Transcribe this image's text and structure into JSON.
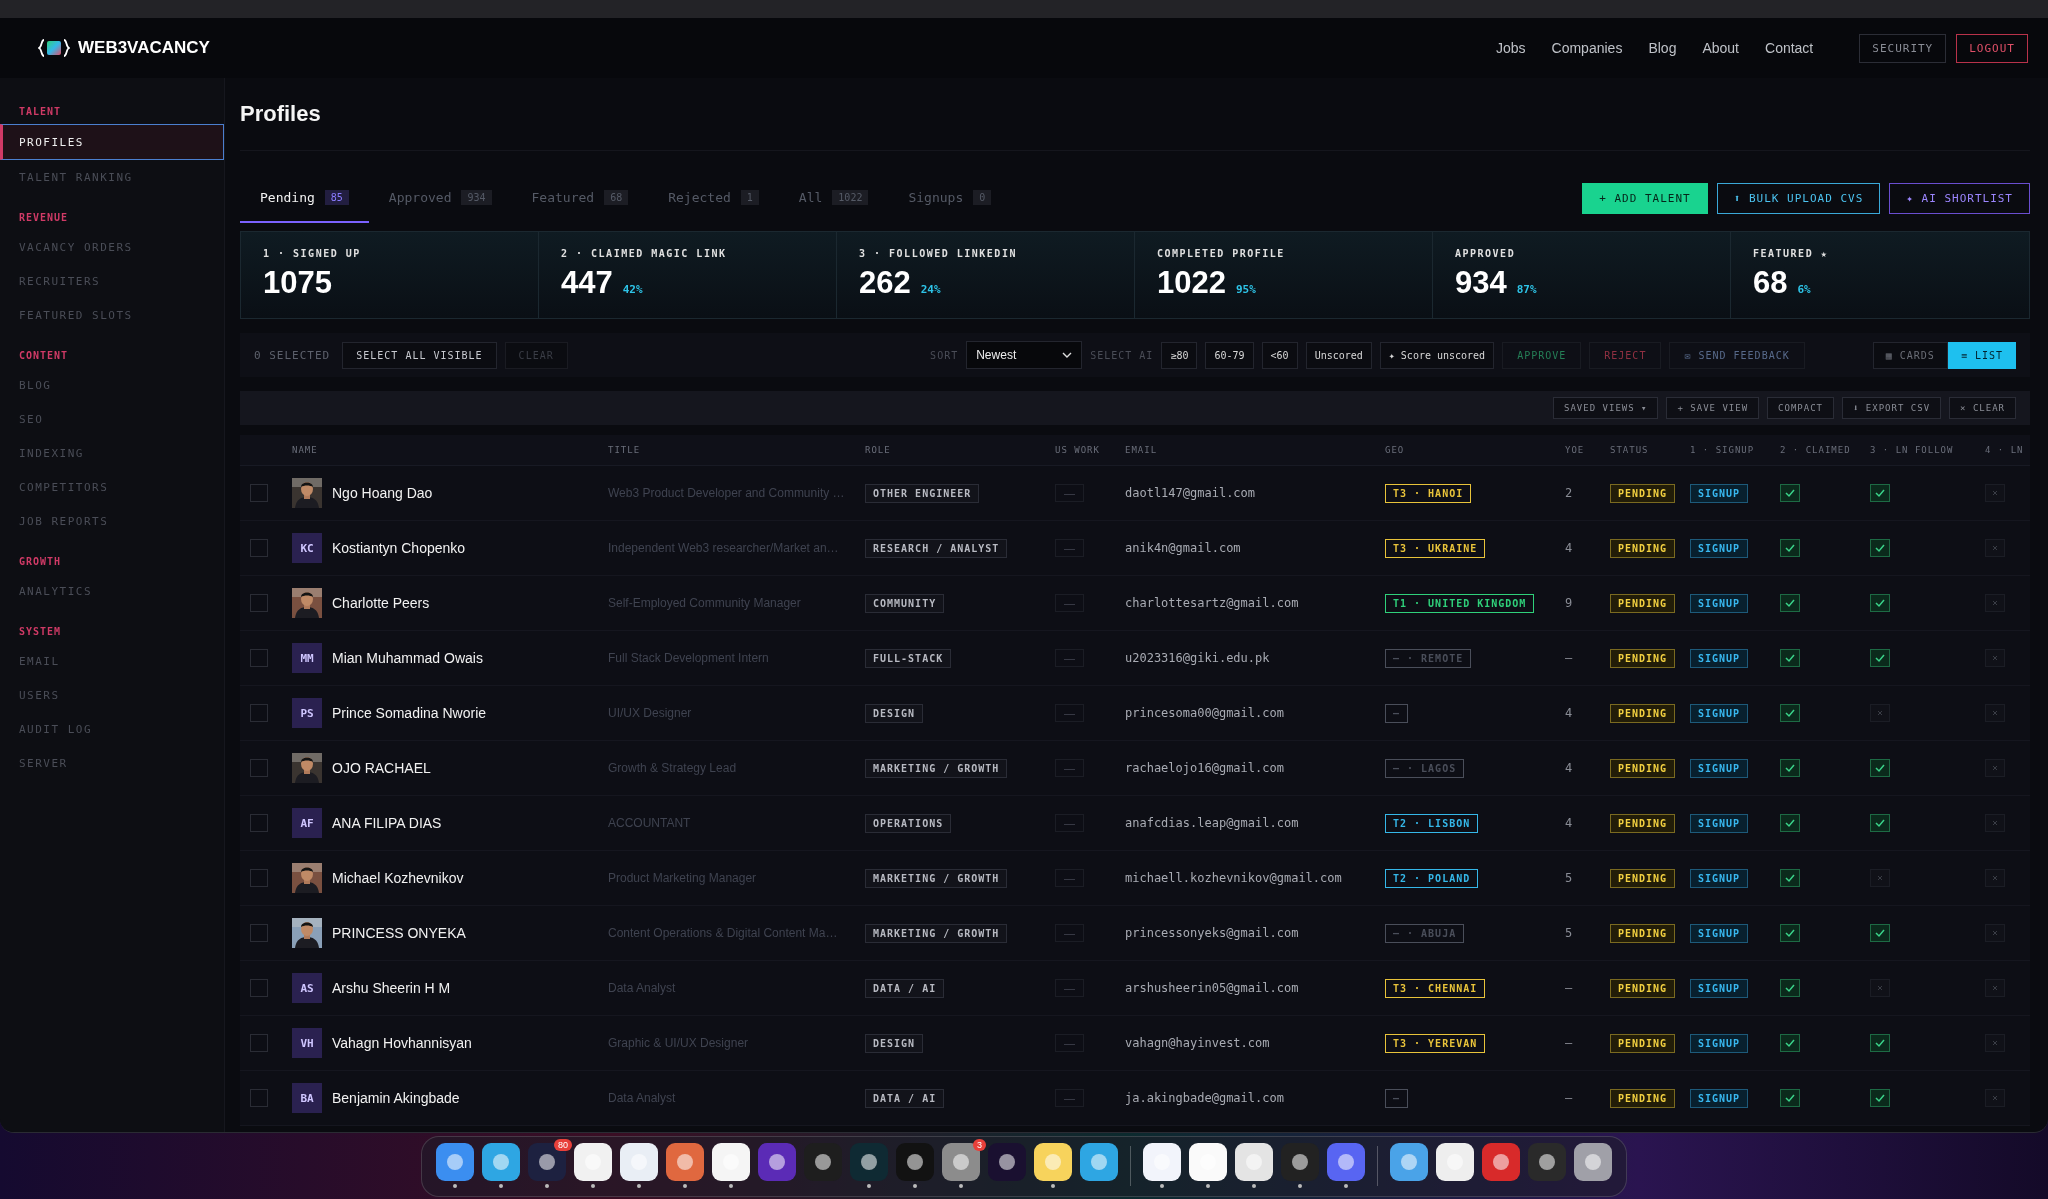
{
  "header": {
    "brand": "WEB3VACANCY",
    "nav": [
      "Jobs",
      "Companies",
      "Blog",
      "About",
      "Contact"
    ],
    "buttons": [
      {
        "label": "SECURITY",
        "kind": "plain"
      },
      {
        "label": "LOGOUT",
        "kind": "danger"
      }
    ]
  },
  "sidebar": {
    "sections": [
      {
        "label": "TALENT",
        "items": [
          {
            "label": "PROFILES",
            "selected": true
          },
          {
            "label": "TALENT RANKING",
            "selected": false
          }
        ]
      },
      {
        "label": "REVENUE",
        "items": [
          {
            "label": "VACANCY ORDERS",
            "selected": false
          },
          {
            "label": "RECRUITERS",
            "selected": false
          },
          {
            "label": "FEATURED SLOTS",
            "selected": false
          }
        ]
      },
      {
        "label": "CONTENT",
        "items": [
          {
            "label": "BLOG",
            "selected": false
          },
          {
            "label": "SEO",
            "selected": false
          },
          {
            "label": "INDEXING",
            "selected": false
          },
          {
            "label": "COMPETITORS",
            "selected": false
          },
          {
            "label": "JOB REPORTS",
            "selected": false
          }
        ]
      },
      {
        "label": "GROWTH",
        "items": [
          {
            "label": "ANALYTICS",
            "selected": false
          }
        ]
      },
      {
        "label": "SYSTEM",
        "items": [
          {
            "label": "EMAIL",
            "selected": false
          },
          {
            "label": "USERS",
            "selected": false
          },
          {
            "label": "AUDIT LOG",
            "selected": false
          },
          {
            "label": "SERVER",
            "selected": false
          }
        ]
      }
    ]
  },
  "page_title": "Profiles",
  "tabs": [
    {
      "label": "Pending",
      "count": "85",
      "selected": true
    },
    {
      "label": "Approved",
      "count": "934",
      "selected": false
    },
    {
      "label": "Featured",
      "count": "68",
      "selected": false
    },
    {
      "label": "Rejected",
      "count": "1",
      "selected": false
    },
    {
      "label": "All",
      "count": "1022",
      "selected": false
    },
    {
      "label": "Signups",
      "count": "0",
      "selected": false
    }
  ],
  "actions": [
    {
      "label": "+ ADD TALENT",
      "kind": "primary"
    },
    {
      "label": "⬆ BULK UPLOAD CVS",
      "kind": "info"
    },
    {
      "label": "✦ AI SHORTLIST",
      "kind": "ai"
    }
  ],
  "stats": [
    {
      "label": "1 · SIGNED UP",
      "value": "1075"
    },
    {
      "label": "2 · CLAIMED MAGIC LINK",
      "value": "447",
      "percent": "42%"
    },
    {
      "label": "3 · FOLLOWED LINKEDIN",
      "value": "262",
      "percent": "24%"
    },
    {
      "label": "COMPLETED PROFILE",
      "value": "1022",
      "percent": "95%"
    },
    {
      "label": "APPROVED",
      "value": "934",
      "percent": "87%"
    },
    {
      "label": "FEATURED ★",
      "value": "68",
      "percent": "6%"
    }
  ],
  "toolbar": {
    "selected_count": "0 SELECTED",
    "select_all": "SELECT ALL VISIBLE",
    "clear": {
      "label": "CLEAR",
      "disabled": true
    },
    "sort_label": "SORT",
    "sort_value": "Newest",
    "select_ai_label": "SELECT AI",
    "ai_filters": [
      "≥80",
      "60-79",
      "<60",
      "Unscored",
      "✦ Score unscored"
    ],
    "bulk_actions": [
      {
        "label": "APPROVE",
        "kind": "approve",
        "disabled": true
      },
      {
        "label": "REJECT",
        "kind": "reject",
        "disabled": true
      },
      {
        "label": "✉ SEND FEEDBACK",
        "kind": "feedback",
        "disabled": true
      }
    ],
    "views": [
      {
        "label": "▦ CARDS",
        "selected": false
      },
      {
        "label": "≡ LIST",
        "selected": true
      }
    ]
  },
  "views_bar": [
    "SAVED VIEWS ▾",
    "+ SAVE VIEW",
    "COMPACT",
    "⬇ EXPORT CSV",
    "× CLEAR"
  ],
  "table": {
    "columns": [
      "NAME",
      "TITLE",
      "ROLE",
      "US WORK",
      "EMAIL",
      "GEO",
      "YOE",
      "STATUS",
      "1 · SIGNUP",
      "2 · CLAIMED",
      "3 · LN FOLLOW",
      "4 · LN"
    ],
    "rows": [
      {
        "checked": false,
        "name": "Ngo Hoang Dao",
        "title": "Web3 Product Developer and Community …",
        "role": "OTHER ENGINEER",
        "us_work": "—",
        "email": "daotl147@gmail.com",
        "geo": {
          "text": "T3 · HANOI",
          "color": "#e8c33a"
        },
        "yoe": "2",
        "status": "PENDING",
        "signup": "SIGNUP",
        "claimed": true,
        "ln_follow": true,
        "column_4": false
      },
      {
        "checked": false,
        "avatar": {
          "kind": "initials",
          "text": "KC"
        },
        "name": "Kostiantyn Chopenko",
        "title": "Independent Web3 researcher/Market an…",
        "role": "RESEARCH / ANALYST",
        "us_work": "—",
        "email": "anik4n@gmail.com",
        "geo": {
          "text": "T3 · UKRAINE",
          "color": "#e8c33a"
        },
        "yoe": "4",
        "status": "PENDING",
        "signup": "SIGNUP",
        "claimed": true,
        "ln_follow": true,
        "column_4": false
      },
      {
        "checked": false,
        "name": "Charlotte Peers",
        "title": "Self-Employed Community Manager",
        "role": "COMMUNITY",
        "us_work": "—",
        "email": "charlottesartz@gmail.com",
        "geo": {
          "text": "T1 · UNITED KINGDOM",
          "color": "#2fd07a"
        },
        "yoe": "9",
        "status": "PENDING",
        "signup": "SIGNUP",
        "claimed": true,
        "ln_follow": true,
        "column_4": false
      },
      {
        "checked": false,
        "avatar": {
          "kind": "initials",
          "text": "MM"
        },
        "name": "Mian Muhammad Owais",
        "title": "Full Stack Development Intern",
        "role": "FULL-STACK",
        "us_work": "—",
        "email": "u2023316@giki.edu.pk",
        "geo": {
          "text": "— · REMOTE",
          "color": "#4a4e5a"
        },
        "yoe": "—",
        "status": "PENDING",
        "signup": "SIGNUP",
        "claimed": true,
        "ln_follow": true,
        "column_4": false
      },
      {
        "checked": false,
        "avatar": {
          "kind": "initials",
          "text": "PS"
        },
        "name": "Prince Somadina Nworie",
        "title": "UI/UX Designer",
        "role": "DESIGN",
        "us_work": "—",
        "email": "princesoma00@gmail.com",
        "geo": {
          "text": "—",
          "color": "#4a4e5a"
        },
        "yoe": "4",
        "status": "PENDING",
        "signup": "SIGNUP",
        "claimed": true,
        "ln_follow": false,
        "column_4": false
      },
      {
        "checked": false,
        "name": "OJO RACHAEL",
        "title": "Growth & Strategy Lead",
        "role": "MARKETING / GROWTH",
        "us_work": "—",
        "email": "rachaelojo16@gmail.com",
        "geo": {
          "text": "— · LAGOS",
          "color": "#4a4e5a"
        },
        "yoe": "4",
        "status": "PENDING",
        "signup": "SIGNUP",
        "claimed": true,
        "ln_follow": true,
        "column_4": false
      },
      {
        "checked": false,
        "avatar": {
          "kind": "initials",
          "text": "AF"
        },
        "name": "ANA FILIPA DIAS",
        "title": "ACCOUNTANT",
        "role": "OPERATIONS",
        "us_work": "—",
        "email": "anafcdias.leap@gmail.com",
        "geo": {
          "text": "T2 · LISBON",
          "color": "#35b7e8"
        },
        "yoe": "4",
        "status": "PENDING",
        "signup": "SIGNUP",
        "claimed": true,
        "ln_follow": true,
        "column_4": false
      },
      {
        "checked": false,
        "name": "Michael Kozhevnikov",
        "title": "Product Marketing Manager",
        "role": "MARKETING / GROWTH",
        "us_work": "—",
        "email": "michaell.kozhevnikov@gmail.com",
        "geo": {
          "text": "T2 · POLAND",
          "color": "#35b7e8"
        },
        "yoe": "5",
        "status": "PENDING",
        "signup": "SIGNUP",
        "claimed": true,
        "ln_follow": false,
        "column_4": false
      },
      {
        "checked": false,
        "name": "PRINCESS ONYEKA",
        "title": "Content Operations & Digital Content Ma…",
        "role": "MARKETING / GROWTH",
        "us_work": "—",
        "email": "princessonyeks@gmail.com",
        "geo": {
          "text": "— · ABUJA",
          "color": "#4a4e5a"
        },
        "yoe": "5",
        "status": "PENDING",
        "signup": "SIGNUP",
        "claimed": true,
        "ln_follow": true,
        "column_4": false
      },
      {
        "checked": false,
        "avatar": {
          "kind": "initials",
          "text": "AS"
        },
        "name": "Arshu Sheerin H M",
        "title": "Data Analyst",
        "role": "DATA / AI",
        "us_work": "—",
        "email": "arshusheerin05@gmail.com",
        "geo": {
          "text": "T3 · CHENNAI",
          "color": "#e8c33a"
        },
        "yoe": "—",
        "status": "PENDING",
        "signup": "SIGNUP",
        "claimed": true,
        "ln_follow": false,
        "column_4": false
      },
      {
        "checked": false,
        "avatar": {
          "kind": "initials",
          "text": "VH"
        },
        "name": "Vahagn Hovhannisyan",
        "title": "Graphic & UI/UX Designer",
        "role": "DESIGN",
        "us_work": "—",
        "email": "vahagn@hayinvest.com",
        "geo": {
          "text": "T3 · YEREVAN",
          "color": "#e8c33a"
        },
        "yoe": "—",
        "status": "PENDING",
        "signup": "SIGNUP",
        "claimed": true,
        "ln_follow": true,
        "column_4": false
      },
      {
        "checked": false,
        "avatar": {
          "kind": "initials",
          "text": "BA"
        },
        "name": "Benjamin Akingbade",
        "title": "Data Analyst",
        "role": "DATA / AI",
        "us_work": "—",
        "email": "ja.akingbade@gmail.com",
        "geo": {
          "text": "—",
          "color": "#4a4e5a"
        },
        "yoe": "—",
        "status": "PENDING",
        "signup": "SIGNUP",
        "claimed": true,
        "ln_follow": true,
        "column_4": false
      }
    ]
  },
  "dock": {
    "groups": [
      [
        {
          "color": "#3b8ef0",
          "running": true
        },
        {
          "color": "#2ea6e3",
          "running": true
        },
        {
          "color": "#1d2140",
          "running": true,
          "badge": "80"
        },
        {
          "color": "#f1f1f1",
          "running": true
        },
        {
          "color": "#e9eef5",
          "running": true
        },
        {
          "color": "#e0683f",
          "running": true
        },
        {
          "color": "#f5f5f5",
          "running": true
        },
        {
          "color": "#5b2bb6",
          "running": false
        },
        {
          "color": "#1e1e1e",
          "running": false
        },
        {
          "color": "#0f2a33",
          "running": true
        },
        {
          "color": "#121212",
          "running": true
        },
        {
          "color": "#8c8c8c",
          "running": true,
          "badge": "3"
        },
        {
          "color": "#1a1030",
          "running": false
        },
        {
          "color": "#f7d35c",
          "running": true
        },
        {
          "color": "#2ea6e3",
          "running": false
        }
      ],
      [
        {
          "color": "#f2f4fb",
          "running": true
        },
        {
          "color": "#fafafa",
          "running": true
        },
        {
          "color": "#e4e4e4",
          "running": true
        },
        {
          "color": "#222222",
          "running": true
        },
        {
          "color": "#5865f2",
          "running": true
        }
      ],
      [
        {
          "color": "#4aa3e8",
          "running": false
        },
        {
          "color": "#eeeeee",
          "running": false
        },
        {
          "color": "#d82a2a",
          "running": false
        },
        {
          "color": "#2a2a2a",
          "running": false
        },
        {
          "color": "#a0a0a8",
          "running": false
        }
      ]
    ]
  }
}
